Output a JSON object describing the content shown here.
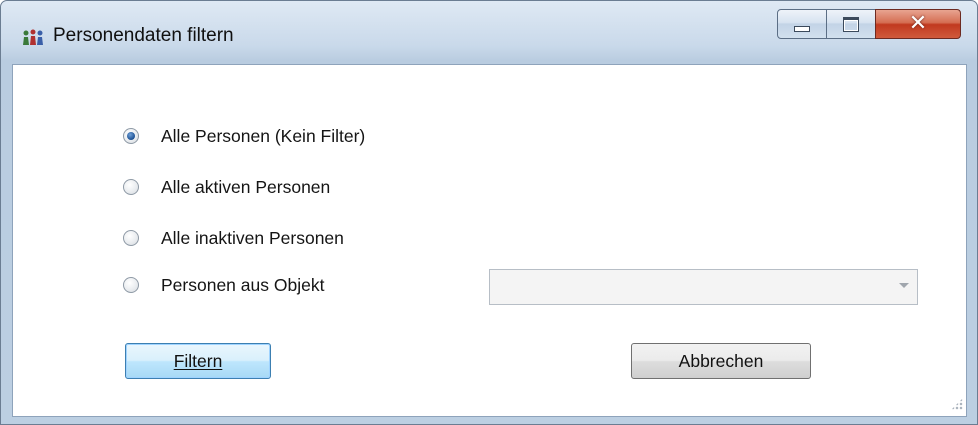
{
  "window": {
    "title": "Personendaten filtern",
    "icon": "app-people-icon",
    "controls": {
      "minimize": "minimize-icon",
      "maximize": "maximize-icon",
      "close": "close-icon"
    }
  },
  "filter_options": [
    {
      "label": "Alle Personen (Kein Filter)",
      "checked": true
    },
    {
      "label": "Alle aktiven Personen",
      "checked": false
    },
    {
      "label": "Alle inaktiven Personen",
      "checked": false
    },
    {
      "label": "Personen aus Objekt",
      "checked": false
    }
  ],
  "object_combo": {
    "value": "",
    "enabled": false
  },
  "buttons": {
    "filter_label": "Filtern",
    "cancel_label": "Abbrechen"
  },
  "colors": {
    "close_button": "#c1391f",
    "default_button_border": "#3c7fb1"
  }
}
